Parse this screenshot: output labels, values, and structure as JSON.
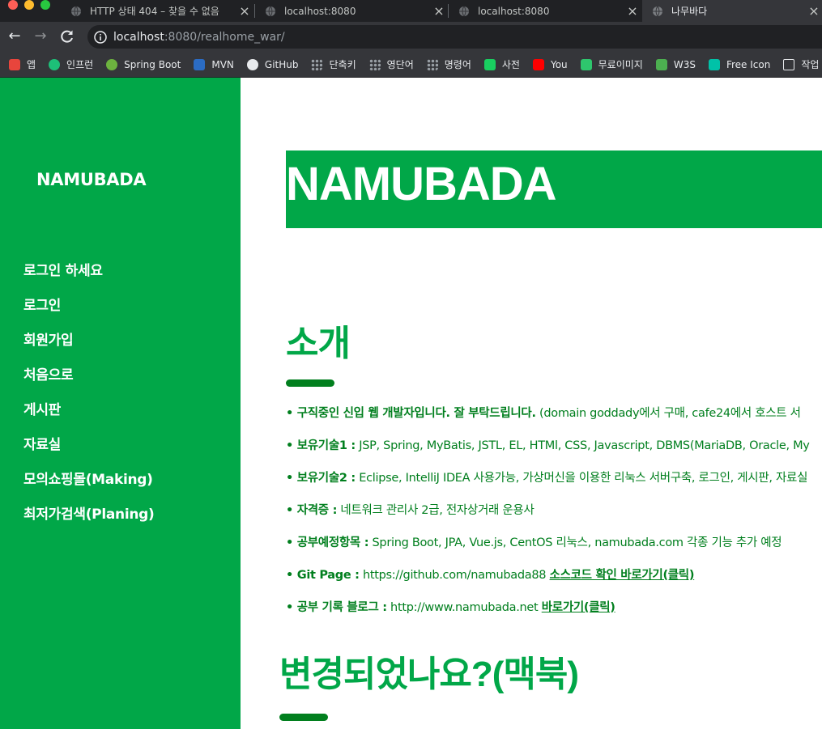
{
  "browser": {
    "tabs": [
      {
        "title": "HTTP 상태 404 – 찾을 수 없음",
        "close": "×"
      },
      {
        "title": "localhost:8080",
        "close": "×"
      },
      {
        "title": "localhost:8080",
        "close": "×"
      },
      {
        "title": "나무바다",
        "close": "×"
      }
    ],
    "url_host": "localhost",
    "url_rest": ":8080/realhome_war/",
    "bookmarks": [
      {
        "label": "앱",
        "icon": "apps-grid-icon",
        "color": "#e8453c"
      },
      {
        "label": "인프런",
        "icon": "inflearn-icon",
        "color": "#1dc078"
      },
      {
        "label": "Spring Boot",
        "icon": "spring-icon",
        "color": "#6db33f"
      },
      {
        "label": "MVN",
        "icon": "mvn-icon",
        "color": "#2b6cc4"
      },
      {
        "label": "GitHub",
        "icon": "github-icon",
        "color": "#e8eaed"
      },
      {
        "label": "단축키",
        "icon": "dots-icon",
        "color": "#9aa0a6"
      },
      {
        "label": "영단어",
        "icon": "dots-icon",
        "color": "#9aa0a6"
      },
      {
        "label": "명령어",
        "icon": "dots-icon",
        "color": "#9aa0a6"
      },
      {
        "label": "사전",
        "icon": "dictionary-icon",
        "color": "#19ce60"
      },
      {
        "label": "You",
        "icon": "youtube-icon",
        "color": "#ff0000"
      },
      {
        "label": "무료이미지",
        "icon": "pixabay-icon",
        "color": "#2ec66d"
      },
      {
        "label": "W3S",
        "icon": "w3s-icon",
        "color": "#4caf50"
      },
      {
        "label": "Free Icon",
        "icon": "freeicon-icon",
        "color": "#00c2a8"
      },
      {
        "label": "작업",
        "icon": "folder-icon",
        "color": "#e8eaed"
      }
    ]
  },
  "sidebar": {
    "brand": "NAMUBADA",
    "menu": [
      "로그인 하세요",
      "로그인",
      "회원가입",
      "처음으로",
      "게시판",
      "자료실",
      "모의쇼핑몰(Making)",
      "최저가검색(Planing)"
    ]
  },
  "main": {
    "banner_title": "NAMUBADA",
    "intro_title": "소개",
    "intro_items": [
      {
        "bullet": "• ",
        "label": "구직중인 신입 웹 개발자입니다. 잘 부탁드립니다.",
        "text": " (domain goddady에서 구매, cafe24에서 호스트 서"
      },
      {
        "bullet": "• ",
        "label": "보유기술1 :",
        "text": " JSP, Spring, MyBatis, JSTL, EL, HTMl, CSS, Javascript, DBMS(MariaDB, Oracle, My"
      },
      {
        "bullet": "• ",
        "label": "보유기술2 :",
        "text": " Eclipse, IntelliJ IDEA 사용가능, 가상머신을 이용한 리눅스 서버구축, 로그인, 게시판, 자료실"
      },
      {
        "bullet": "• ",
        "label": "자격증 :",
        "text": " 네트워크 관리사 2급, 전자상거래 운용사"
      },
      {
        "bullet": "• ",
        "label": "공부예정항목 :",
        "text": " Spring Boot, JPA, Vue.js, CentOS 리눅스, namubada.com 각종 기능 추가 예정"
      },
      {
        "bullet": "• ",
        "label": "Git Page :",
        "text": " https://github.com/namubada88 ",
        "link": "소스코드 확인 바로가기(클릭)"
      },
      {
        "bullet": "• ",
        "label": "공부 기록 블로그 :",
        "text": " http://www.namubada.net ",
        "link": "바로가기(클릭)"
      }
    ],
    "second_title": "변경되었나요?(맥북)"
  },
  "colors": {
    "brand_green": "#01a748",
    "dark_green": "#017f1e"
  }
}
